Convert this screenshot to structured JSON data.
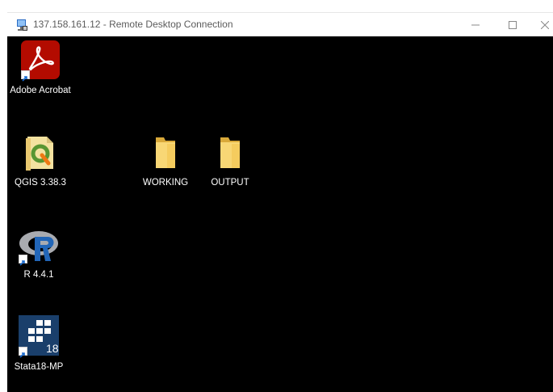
{
  "window": {
    "title": "137.158.161.12 - Remote Desktop Connection"
  },
  "desktop": {
    "icons": [
      {
        "label": "Adobe Acrobat",
        "icon": "adobe-acrobat-icon",
        "shortcut": true
      },
      {
        "label": "QGIS 3.38.3",
        "icon": "qgis-icon",
        "shortcut": false
      },
      {
        "label": "WORKING",
        "icon": "folder-icon",
        "shortcut": false
      },
      {
        "label": "OUTPUT",
        "icon": "folder-icon",
        "shortcut": false
      },
      {
        "label": "R 4.4.1",
        "icon": "r-icon",
        "shortcut": true
      },
      {
        "label": "Stata18-MP",
        "icon": "stata-icon",
        "shortcut": true
      }
    ],
    "stata_badge": "18"
  },
  "colors": {
    "desktop_bg": "#000000",
    "acrobat_red": "#B30B00",
    "folder_yellow": "#F8D775",
    "r_blue": "#2266B8",
    "stata_navy": "#1A3F6B"
  }
}
